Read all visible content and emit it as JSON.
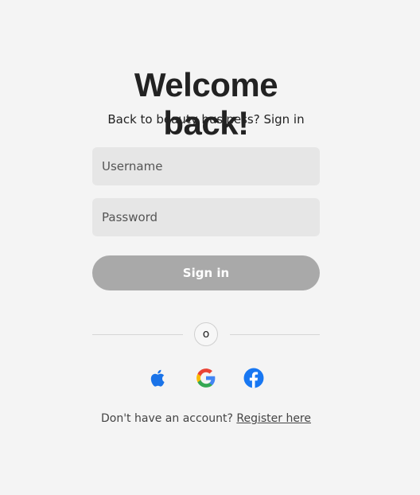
{
  "header": {
    "title": "Welcome back!",
    "subtitle": "Back to beauty business? Sign in"
  },
  "form": {
    "username_placeholder": "Username",
    "password_placeholder": "Password",
    "signin_label": "Sign in"
  },
  "divider": {
    "label": "o"
  },
  "social": {
    "apple_icon": "apple-icon",
    "google_icon": "google-icon",
    "facebook_icon": "facebook-icon",
    "apple_color": "#1a73e8",
    "facebook_color": "#1877f2"
  },
  "footer": {
    "prompt": "Don't have an account?",
    "register_link": "Register here"
  },
  "colors": {
    "background": "#f4f4f4",
    "field_background": "#e6e6e6",
    "button_background": "#a9a9a9",
    "button_text": "#ffffff"
  }
}
